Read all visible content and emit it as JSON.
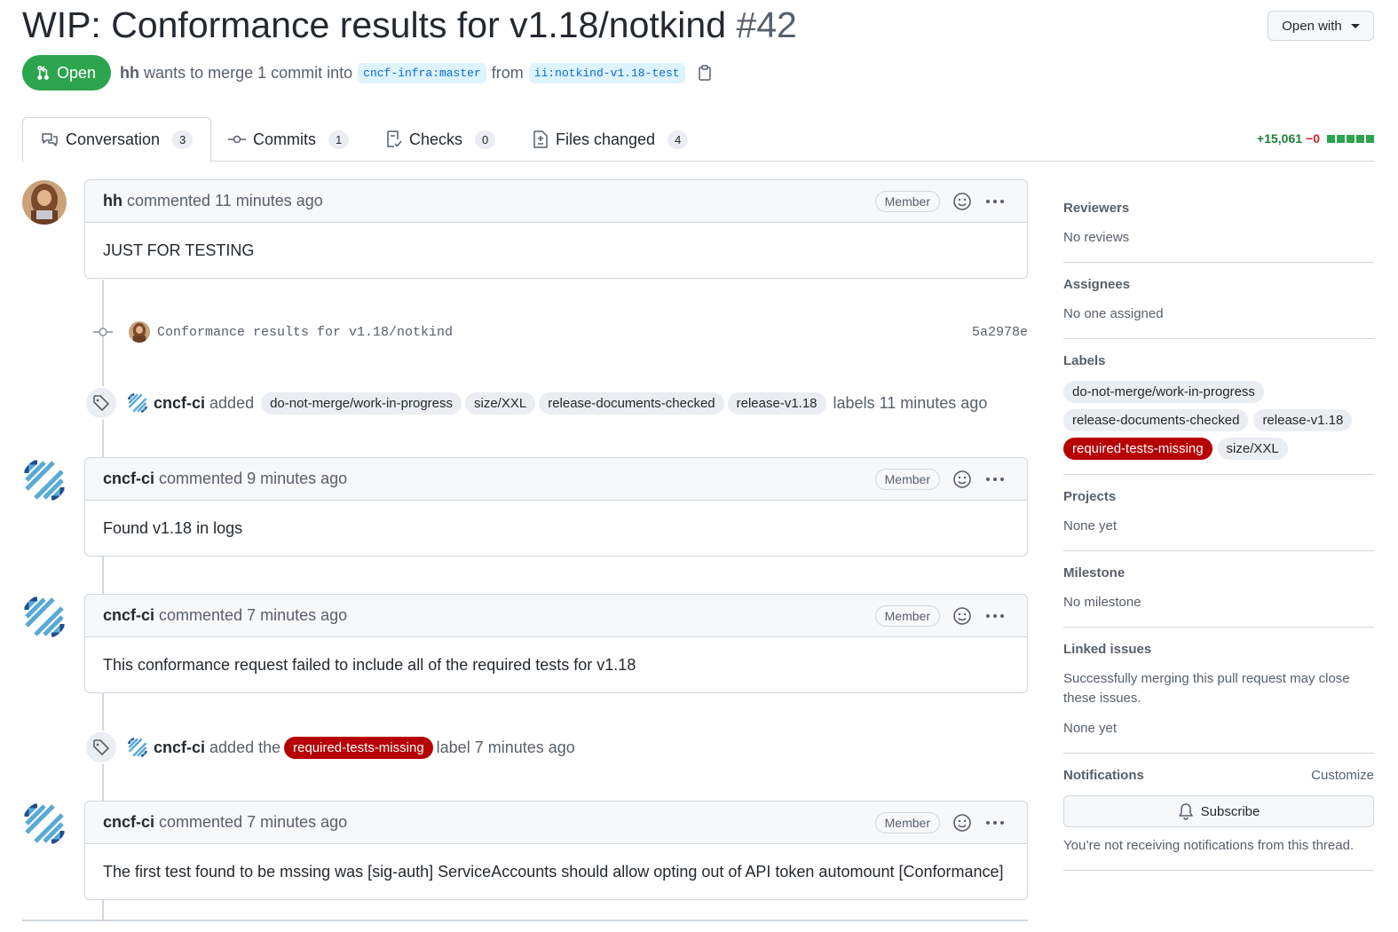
{
  "pr": {
    "title": "WIP: Conformance results for v1.18/notkind",
    "number": "#42",
    "state": "Open",
    "author": "hh",
    "merge_text": "wants to merge 1 commit into",
    "base_branch": "cncf-infra:master",
    "from_text": "from",
    "head_branch": "ii:notkind-v1.18-test"
  },
  "open_with": {
    "label": "Open with"
  },
  "tabs": [
    {
      "label": "Conversation",
      "count": "3"
    },
    {
      "label": "Commits",
      "count": "1"
    },
    {
      "label": "Checks",
      "count": "0"
    },
    {
      "label": "Files changed",
      "count": "4"
    }
  ],
  "diffstat": {
    "additions": "+15,061",
    "deletions": "−0"
  },
  "timeline": {
    "c1": {
      "author": "hh",
      "action": "commented",
      "time": "11 minutes ago",
      "role": "Member",
      "body": "JUST FOR TESTING"
    },
    "commit": {
      "message": "Conformance results for v1.18/notkind",
      "sha": "5a2978e"
    },
    "e1": {
      "actor": "cncf-ci",
      "action": "added",
      "labels": [
        "do-not-merge/work-in-progress",
        "size/XXL",
        "release-documents-checked",
        "release-v1.18"
      ],
      "suffix": "labels",
      "time": "11 minutes ago"
    },
    "c2": {
      "author": "cncf-ci",
      "action": "commented",
      "time": "9 minutes ago",
      "role": "Member",
      "body": "Found v1.18 in logs"
    },
    "c3": {
      "author": "cncf-ci",
      "action": "commented",
      "time": "7 minutes ago",
      "role": "Member",
      "body": "This conformance request failed to include all of the required tests for v1.18"
    },
    "e2": {
      "actor": "cncf-ci",
      "action": "added the",
      "label": "required-tests-missing",
      "suffix": "label",
      "time": "7 minutes ago"
    },
    "c4": {
      "author": "cncf-ci",
      "action": "commented",
      "time": "7 minutes ago",
      "role": "Member",
      "body": "The first test found to be mssing was [sig-auth] ServiceAccounts should allow opting out of API token automount [Conformance]"
    }
  },
  "sidebar": {
    "reviewers": {
      "title": "Reviewers",
      "value": "No reviews"
    },
    "assignees": {
      "title": "Assignees",
      "value": "No one assigned"
    },
    "labels": {
      "title": "Labels",
      "items": [
        "do-not-merge/work-in-progress",
        "release-documents-checked",
        "release-v1.18",
        "required-tests-missing",
        "size/XXL"
      ]
    },
    "projects": {
      "title": "Projects",
      "value": "None yet"
    },
    "milestone": {
      "title": "Milestone",
      "value": "No milestone"
    },
    "linked_issues": {
      "title": "Linked issues",
      "description": "Successfully merging this pull request may close these issues.",
      "value": "None yet"
    },
    "notifications": {
      "title": "Notifications",
      "customize": "Customize",
      "subscribe": "Subscribe",
      "status": "You’re not receiving notifications from this thread."
    }
  },
  "colors": {
    "open_green": "#2da44e",
    "required_label_red": "#b60205",
    "link_blue": "#0969da"
  }
}
